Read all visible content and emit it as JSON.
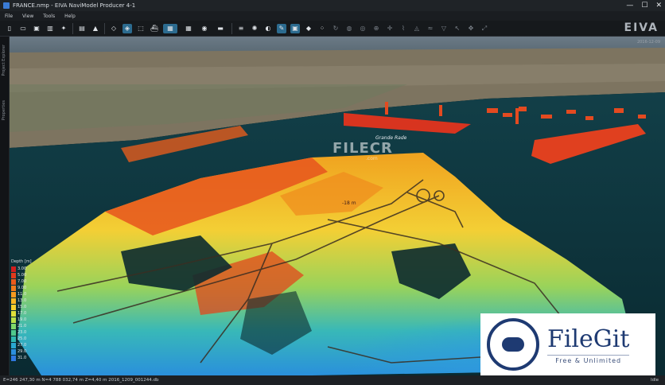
{
  "window": {
    "title": "FRANCE.nmp - EIVA NaviModel Producer 4-1"
  },
  "menu": {
    "items": [
      "File",
      "View",
      "Tools",
      "Help"
    ]
  },
  "brand": {
    "text": "EIVA"
  },
  "viewport": {
    "coord_readout": "2016-12-09",
    "scene_label": "Grande Rade",
    "depth_mark": "-18 m"
  },
  "legend": {
    "title": "Depth [m]",
    "values": [
      "3.00",
      "5.00",
      "7.00",
      "9.00",
      "11.0",
      "13.0",
      "15.0",
      "17.0",
      "19.0",
      "21.0",
      "23.0",
      "25.0",
      "27.0",
      "29.0",
      "31.0"
    ],
    "colors": [
      "#d11f1f",
      "#e03a1c",
      "#ea5a1b",
      "#f07a1b",
      "#f59a1f",
      "#f8b825",
      "#f5d02d",
      "#dfe03a",
      "#b8e04a",
      "#7fd86a",
      "#4fc98c",
      "#2fb8b0",
      "#29a8cf",
      "#2b8fde",
      "#2f78e0"
    ]
  },
  "status": {
    "left": "E=246 247,30 m N=4 788 032,74 m Z=4,40 m 2016_1209_001244.db",
    "right": "Idle"
  },
  "watermarks": {
    "filecr": "FILECR",
    "filecr_sub": ".com",
    "filegit_name": "FileGit",
    "filegit_tag": "Free & Unlimited"
  },
  "colors": {
    "water": "#0f3b45",
    "toolbar": "#16191c",
    "active_tool": "#2c6b8f",
    "brand_blue": "#1e3a72"
  }
}
